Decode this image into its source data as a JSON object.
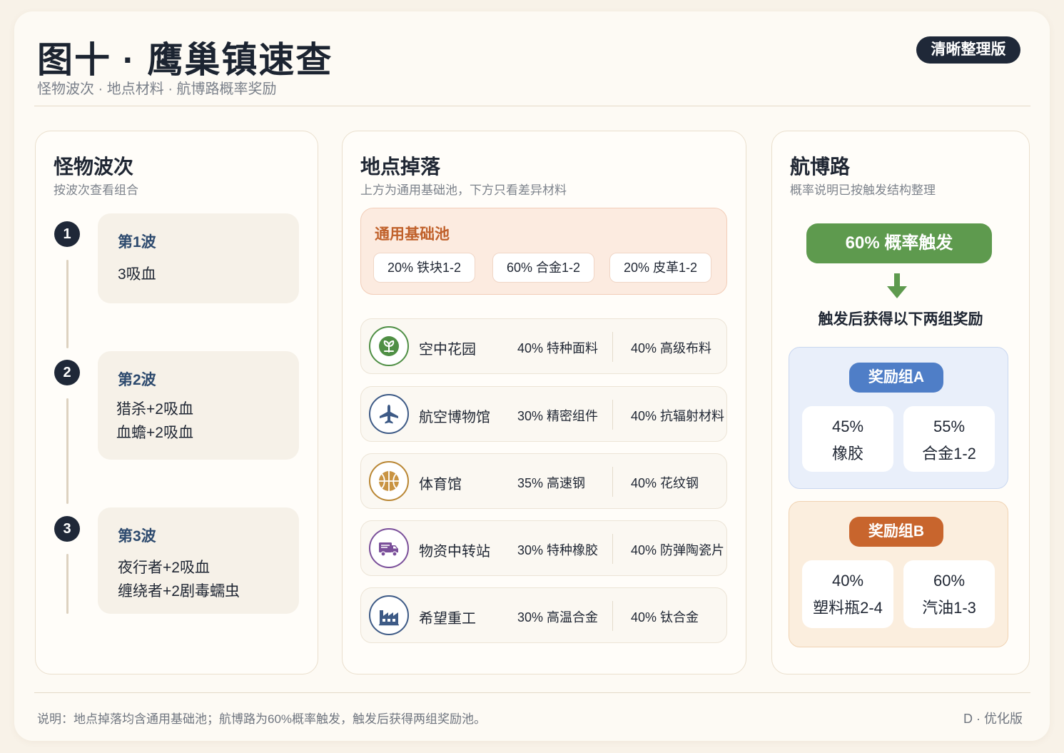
{
  "header": {
    "title": "图十 · 鹰巢镇速查",
    "subtitle": "怪物波次 · 地点材料 · 航博路概率奖励",
    "badge": "清晰整理版"
  },
  "waves_panel": {
    "title": "怪物波次",
    "subtitle": "按波次查看组合",
    "waves": [
      {
        "number": "1",
        "title": "第1波",
        "line1": "3吸血",
        "line2": ""
      },
      {
        "number": "2",
        "title": "第2波",
        "line1": "猎杀+2吸血",
        "line2": "血蟾+2吸血"
      },
      {
        "number": "3",
        "title": "第3波",
        "line1": "夜行者+2吸血",
        "line2": "缠绕者+2剧毒蠕虫"
      }
    ]
  },
  "drops_panel": {
    "title": "地点掉落",
    "subtitle": "上方为通用基础池，下方只看差异材料",
    "base_pool": {
      "title": "通用基础池",
      "items": [
        "20% 铁块1-2",
        "60% 合金1-2",
        "20% 皮革1-2"
      ]
    },
    "locations": [
      {
        "name": "空中花园",
        "icon": "plant-icon",
        "color": "#4f8f45",
        "drop1": "40% 特种面料",
        "drop2": "40% 高级布料"
      },
      {
        "name": "航空博物馆",
        "icon": "airplane-icon",
        "color": "#3d5a86",
        "drop1": "30% 精密组件",
        "drop2": "40% 抗辐射材料"
      },
      {
        "name": "体育馆",
        "icon": "basketball-icon",
        "color": "#b98633",
        "drop1": "35% 高速钢",
        "drop2": "40% 花纹钢"
      },
      {
        "name": "物资中转站",
        "icon": "truck-icon",
        "color": "#7a4f9a",
        "drop1": "30% 特种橡胶",
        "drop2": "40% 防弹陶瓷片"
      },
      {
        "name": "希望重工",
        "icon": "factory-icon",
        "color": "#3d5a86",
        "drop1": "30% 高温合金",
        "drop2": "40% 钛合金"
      }
    ]
  },
  "reward_panel": {
    "title": "航博路",
    "subtitle": "概率说明已按触发结构整理",
    "trigger": "60% 概率触发",
    "after_text": "触发后获得以下两组奖励",
    "groups": [
      {
        "label": "奖励组A",
        "color": "#4f7ec7",
        "items": [
          {
            "pct": "45%",
            "name": "橡胶"
          },
          {
            "pct": "55%",
            "name": "合金1-2"
          }
        ]
      },
      {
        "label": "奖励组B",
        "color": "#c8652d",
        "items": [
          {
            "pct": "40%",
            "name": "塑料瓶2-4"
          },
          {
            "pct": "60%",
            "name": "汽油1-3"
          }
        ]
      }
    ]
  },
  "footer": {
    "note": "说明：地点掉落均含通用基础池；航博路为60%概率触发，触发后获得两组奖励池。",
    "version": "D · 优化版"
  }
}
